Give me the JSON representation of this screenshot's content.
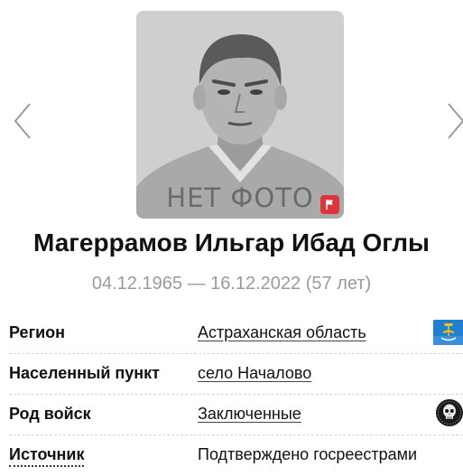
{
  "photo": {
    "placeholder_text": "НЕТ ФОТО",
    "flag_icon": "flag-icon",
    "flag_color": "#e0343c"
  },
  "carousel": {
    "prev_icon": "chevron-left-icon",
    "next_icon": "chevron-right-icon"
  },
  "person": {
    "name": "Магеррамов Ильгар Ибад Оглы",
    "dates": "04.12.1965 — 16.12.2022 (57 лет)"
  },
  "info": [
    {
      "label": "Регион",
      "value": "Астраханская область",
      "link": true,
      "icon": "astrakhan-region-flag-icon"
    },
    {
      "label": "Населенный пункт",
      "value": "село Началово",
      "link": true
    },
    {
      "label": "Род войск",
      "value": "Заключенные",
      "link": true,
      "icon": "skull-icon"
    },
    {
      "label": "Источник",
      "value": "Подтверждено госреестрами",
      "link": false
    }
  ]
}
